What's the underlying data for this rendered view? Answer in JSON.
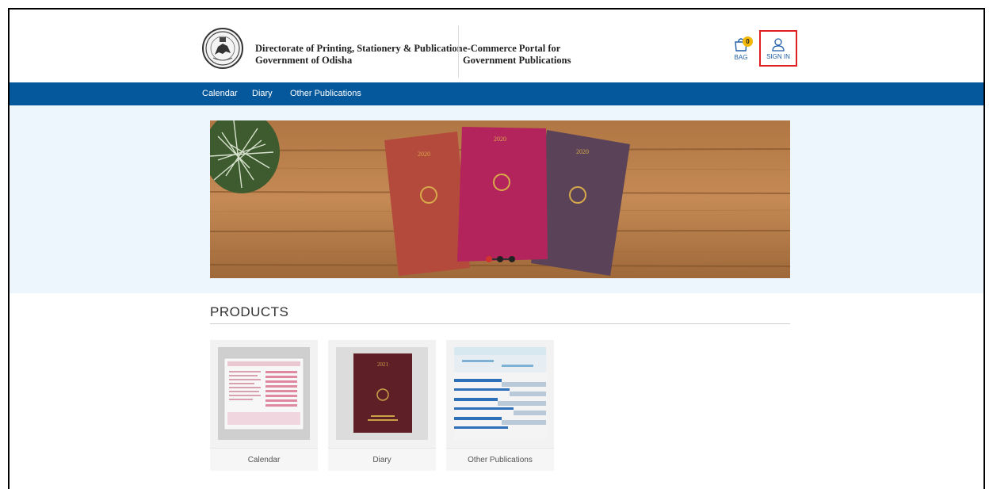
{
  "header": {
    "org_line1": "Directorate of Printing, Stationery & Publication",
    "org_line2": "Government of Odisha",
    "portal_line1": "e-Commerce Portal for",
    "portal_line2": "Government Publications",
    "bag_label": "BAG",
    "bag_count": "0",
    "signin_label": "SIGN IN"
  },
  "nav": {
    "items": [
      "Calendar",
      "Diary",
      "Other Publications"
    ]
  },
  "banner": {
    "book_year": "2020",
    "slides": 3,
    "active_slide": 0
  },
  "products": {
    "title": "PRODUCTS",
    "items": [
      {
        "label": "Calendar"
      },
      {
        "label": "Diary",
        "year": "2021"
      },
      {
        "label": "Other Publications"
      }
    ]
  },
  "colors": {
    "nav_bg": "#04589b",
    "hero_bg": "#edf6fc",
    "signin_border": "#e02020",
    "badge": "#f2b705"
  }
}
